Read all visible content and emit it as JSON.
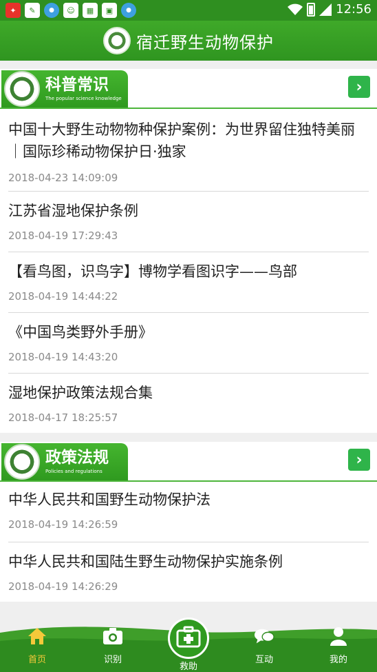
{
  "status_bar": {
    "time": "12:56"
  },
  "header": {
    "title": "宿迁野生动物保护"
  },
  "sections": [
    {
      "title": "科普常识",
      "subtitle": "The popular science knowledge",
      "articles": [
        {
          "title": "中国十大野生动物物种保护案例：为世界留住独特美丽｜国际珍稀动物保护日·独家",
          "date": "2018-04-23 14:09:09"
        },
        {
          "title": "江苏省湿地保护条例",
          "date": "2018-04-19 17:29:43"
        },
        {
          "title": "【看鸟图，识鸟字】博物学看图识字——鸟部",
          "date": "2018-04-19 14:44:22"
        },
        {
          "title": "《中国鸟类野外手册》",
          "date": "2018-04-19 14:43:20"
        },
        {
          "title": "湿地保护政策法规合集",
          "date": "2018-04-17 18:25:57"
        }
      ]
    },
    {
      "title": "政策法规",
      "subtitle": "Policies and regulations",
      "articles": [
        {
          "title": "中华人民共和国野生动物保护法",
          "date": "2018-04-19 14:26:59"
        },
        {
          "title": "中华人民共和国陆生野生动物保护实施条例",
          "date": "2018-04-19 14:26:29"
        }
      ]
    }
  ],
  "nav": {
    "items": [
      {
        "label": "首页",
        "icon": "home-icon",
        "active": true
      },
      {
        "label": "识别",
        "icon": "camera-icon",
        "active": false
      },
      {
        "label": "救助",
        "icon": "first-aid-icon",
        "active": false
      },
      {
        "label": "互动",
        "icon": "chat-icon",
        "active": false
      },
      {
        "label": "我的",
        "icon": "user-icon",
        "active": false
      }
    ]
  },
  "colors": {
    "primary_green": "#3fa929",
    "accent_green": "#2fb44a",
    "active_yellow": "#f5c93a"
  }
}
